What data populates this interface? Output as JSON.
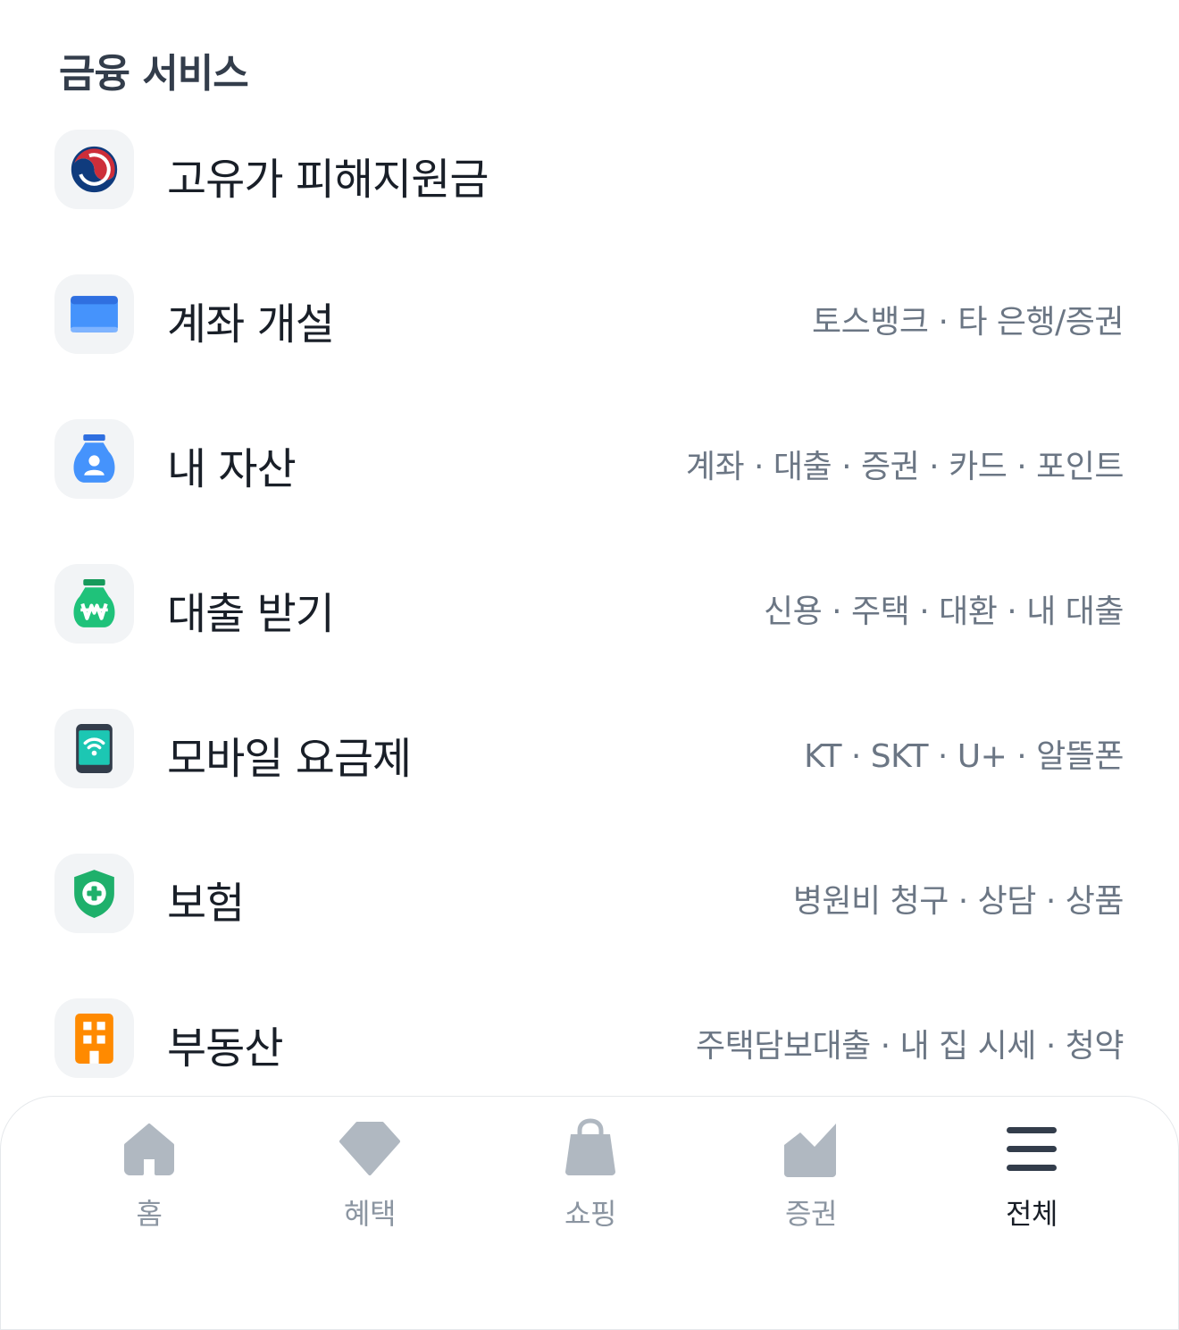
{
  "section": {
    "title": "금융 서비스"
  },
  "items": [
    {
      "label": "고유가 피해지원금",
      "sub": "",
      "icon": "korea-emblem-icon"
    },
    {
      "label": "계좌 개설",
      "sub": "토스뱅크 · 타 은행/증권",
      "icon": "card-icon"
    },
    {
      "label": "내 자산",
      "sub": "계좌 · 대출 · 증권 · 카드 · 포인트",
      "icon": "money-bag-icon"
    },
    {
      "label": "대출 받기",
      "sub": "신용 · 주택 · 대환 · 내 대출",
      "icon": "won-bag-icon"
    },
    {
      "label": "모바일 요금제",
      "sub": "KT · SKT · U+ · 알뜰폰",
      "icon": "phone-wifi-icon"
    },
    {
      "label": "보험",
      "sub": "병원비 청구 · 상담 · 상품",
      "icon": "shield-cross-icon"
    },
    {
      "label": "부동산",
      "sub": "주택담보대출 · 내 집 시세 · 청약",
      "icon": "building-icon"
    }
  ],
  "nav": [
    {
      "label": "홈",
      "icon": "home-icon",
      "active": false
    },
    {
      "label": "혜택",
      "icon": "gem-icon",
      "active": false
    },
    {
      "label": "쇼핑",
      "icon": "shopping-bag-icon",
      "active": false
    },
    {
      "label": "증권",
      "icon": "stock-chart-icon",
      "active": false
    },
    {
      "label": "전체",
      "icon": "menu-icon",
      "active": true
    }
  ],
  "colors": {
    "title": "#333d4b",
    "label": "#191f28",
    "sub": "#6b7684",
    "nav_inactive": "#8b95a1",
    "nav_active": "#191f28",
    "icon_bg": "#f2f4f6"
  }
}
